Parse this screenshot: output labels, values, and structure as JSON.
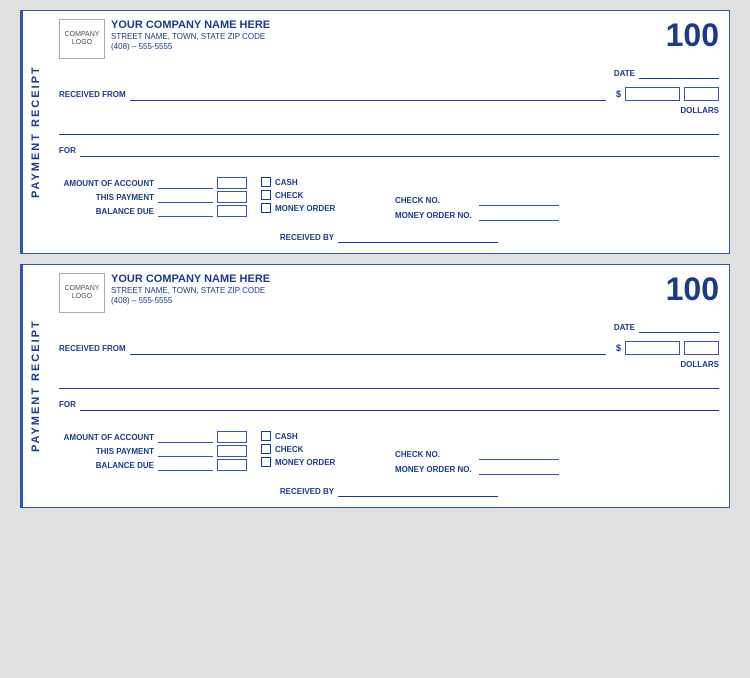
{
  "receipts": [
    {
      "id": "receipt-1",
      "vertical_label": "PAYMENT RECEIPT",
      "receipt_number": "100",
      "logo": {
        "line1": "COMPANY",
        "line2": "LOGO"
      },
      "company": {
        "name": "YOUR COMPANY NAME HERE",
        "address": "STREET NAME, TOWN, STATE  ZIP CODE",
        "phone": "(408) – 555-5555"
      },
      "date_label": "DATE",
      "received_from_label": "RECEIVED FROM",
      "dollars_label": "DOLLARS",
      "for_label": "FOR",
      "account_rows": [
        {
          "label": "AMOUNT OF ACCOUNT"
        },
        {
          "label": "THIS PAYMENT"
        },
        {
          "label": "BALANCE DUE"
        }
      ],
      "payment_types": [
        {
          "label": "CASH"
        },
        {
          "label": "CHECK"
        },
        {
          "label": "MONEY ORDER"
        }
      ],
      "check_no_label": "CHECK NO.",
      "money_order_no_label": "MONEY ORDER NO.",
      "received_by_label": "RECEIVED BY"
    },
    {
      "id": "receipt-2",
      "vertical_label": "PAYMENT RECEIPT",
      "receipt_number": "100",
      "logo": {
        "line1": "COMPANY",
        "line2": "LOGO"
      },
      "company": {
        "name": "YOUR COMPANY NAME HERE",
        "address": "STREET NAME, TOWN, STATE  ZIP CODE",
        "phone": "(408) – 555-5555"
      },
      "date_label": "DATE",
      "received_from_label": "RECEIVED FROM",
      "dollars_label": "DOLLARS",
      "for_label": "FOR",
      "account_rows": [
        {
          "label": "AMOUNT OF ACCOUNT"
        },
        {
          "label": "THIS PAYMENT"
        },
        {
          "label": "BALANCE DUE"
        }
      ],
      "payment_types": [
        {
          "label": "CASH"
        },
        {
          "label": "CHECK"
        },
        {
          "label": "MONEY ORDER"
        }
      ],
      "check_no_label": "CHECK NO.",
      "money_order_no_label": "MONEY ORDER NO.",
      "received_by_label": "RECEIVED BY"
    }
  ]
}
